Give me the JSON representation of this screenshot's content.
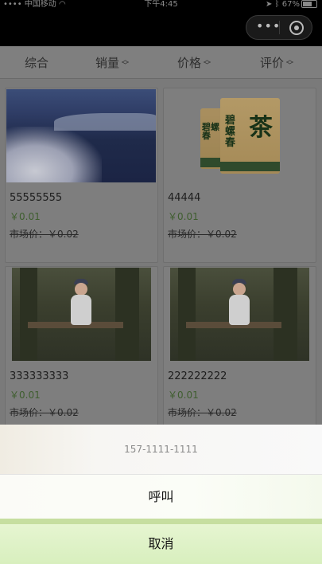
{
  "status_bar": {
    "carrier": "中国移动",
    "time": "下午4:45",
    "battery": "67%"
  },
  "nav": {
    "more_icon": "more-dots-icon",
    "target_icon": "target-circle-icon"
  },
  "sort_bar": {
    "items": [
      {
        "label": "综合",
        "arrows": false
      },
      {
        "label": "销量",
        "arrows": true
      },
      {
        "label": "价格",
        "arrows": true
      },
      {
        "label": "评价",
        "arrows": true
      }
    ]
  },
  "products": [
    {
      "name": "55555555",
      "price": "￥0.01",
      "market_price": "市场价：￥0.02",
      "image": "winter-lake"
    },
    {
      "name": "44444",
      "price": "￥0.01",
      "market_price": "市场价：￥0.02",
      "image": "tea-packages"
    },
    {
      "name": "333333333",
      "price": "￥0.01",
      "market_price": "市场价：￥0.02",
      "image": "girl-on-bench"
    },
    {
      "name": "222222222",
      "price": "￥0.01",
      "market_price": "市场价：￥0.02",
      "image": "girl-on-bench"
    }
  ],
  "action_sheet": {
    "phone": "157-1111-1111",
    "call_label": "呼叫",
    "cancel_label": "取消"
  },
  "tea_bag_text": {
    "brand": "碧螺春",
    "big_char": "茶"
  }
}
